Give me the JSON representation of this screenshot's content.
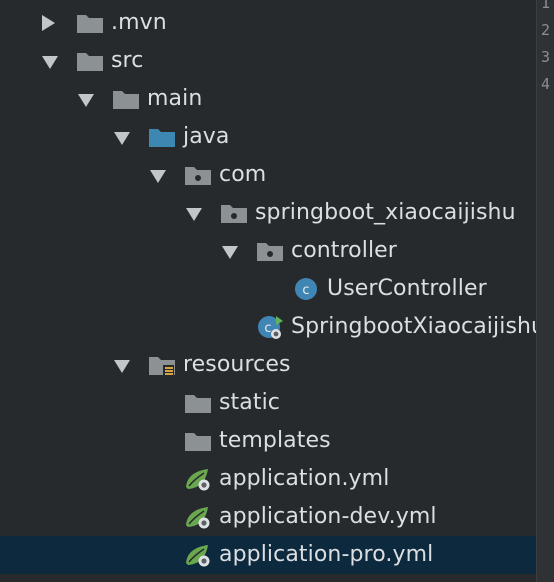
{
  "tree": [
    {
      "label": ".mvn",
      "depth": 0,
      "arrow": "collapsed",
      "icon": "folder-icon"
    },
    {
      "label": "src",
      "depth": 0,
      "arrow": "expanded",
      "icon": "folder-icon"
    },
    {
      "label": "main",
      "depth": 1,
      "arrow": "expanded",
      "icon": "folder-icon"
    },
    {
      "label": "java",
      "depth": 2,
      "arrow": "expanded",
      "icon": "source-folder-icon"
    },
    {
      "label": "com",
      "depth": 3,
      "arrow": "expanded",
      "icon": "package-icon"
    },
    {
      "label": "springboot_xiaocaijishu",
      "depth": 4,
      "arrow": "expanded",
      "icon": "package-icon"
    },
    {
      "label": "controller",
      "depth": 5,
      "arrow": "expanded",
      "icon": "package-icon"
    },
    {
      "label": "UserController",
      "depth": 6,
      "arrow": "none",
      "icon": "class-icon"
    },
    {
      "label": "SpringbootXiaocaijishu",
      "depth": 5,
      "arrow": "none",
      "icon": "spring-boot-class-icon"
    },
    {
      "label": "resources",
      "depth": 2,
      "arrow": "expanded",
      "icon": "resources-folder-icon"
    },
    {
      "label": "static",
      "depth": 3,
      "arrow": "none",
      "icon": "folder-icon"
    },
    {
      "label": "templates",
      "depth": 3,
      "arrow": "none",
      "icon": "folder-icon"
    },
    {
      "label": "application.yml",
      "depth": 3,
      "arrow": "none",
      "icon": "spring-config-icon"
    },
    {
      "label": "application-dev.yml",
      "depth": 3,
      "arrow": "none",
      "icon": "spring-config-icon"
    },
    {
      "label": "application-pro.yml",
      "depth": 3,
      "arrow": "none",
      "icon": "spring-config-icon",
      "selected": true
    }
  ],
  "gutter": {
    "line_numbers": [
      "1",
      "2",
      "3",
      "4"
    ]
  },
  "colors": {
    "background": "#272a2c",
    "selection": "#0d293e",
    "text": "#dcdfe1",
    "folder": "#8c9194",
    "source_folder": "#3d88b3",
    "class_icon": "#3f86b4",
    "spring_green": "#6aa84f"
  }
}
